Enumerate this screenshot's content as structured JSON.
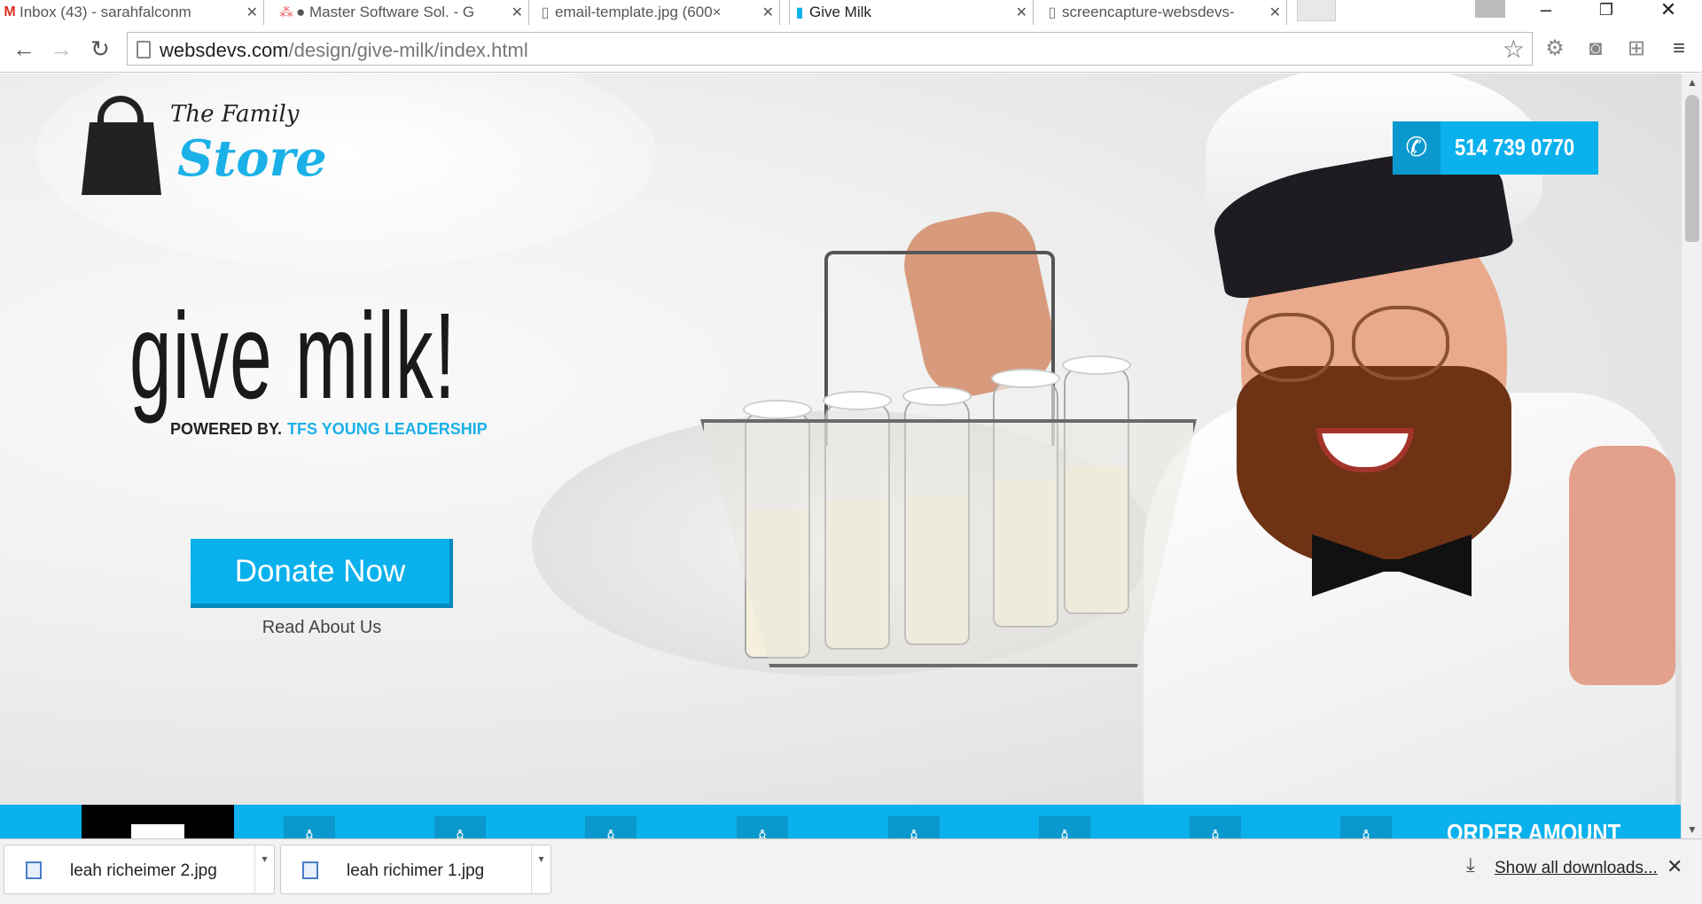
{
  "browser": {
    "tabs": [
      {
        "title": "Inbox (43) - sarahfalconm",
        "icon": "gmail-icon",
        "active": false
      },
      {
        "title": "● Master Software Sol. - G",
        "icon": "asana-icon",
        "active": false
      },
      {
        "title": "email-template.jpg (600×",
        "icon": "page-icon",
        "active": false
      },
      {
        "title": "Give Milk",
        "icon": "milk-bottle-icon",
        "active": true
      },
      {
        "title": "screencapture-websdevs-",
        "icon": "page-icon",
        "active": false
      }
    ],
    "url_host": "websdevs.com",
    "url_path": "/design/give-milk/index.html"
  },
  "page": {
    "logo": {
      "line1": "The Family",
      "line2": "Store"
    },
    "headline": "give milk!",
    "powered_by": "POWERED BY.",
    "powered_org": "TFS YOUNG LEADERSHIP",
    "donate_label": "Donate Now",
    "read_label": "Read About Us",
    "phone": "514 739 0770",
    "strip_label": "ORDER AMOUNT"
  },
  "downloads": {
    "items": [
      "leah richeimer 2.jpg",
      "leah richimer 1.jpg"
    ],
    "show_all": "Show all downloads..."
  },
  "colors": {
    "accent": "#0ab1ec",
    "accent_dark": "#0389be"
  }
}
